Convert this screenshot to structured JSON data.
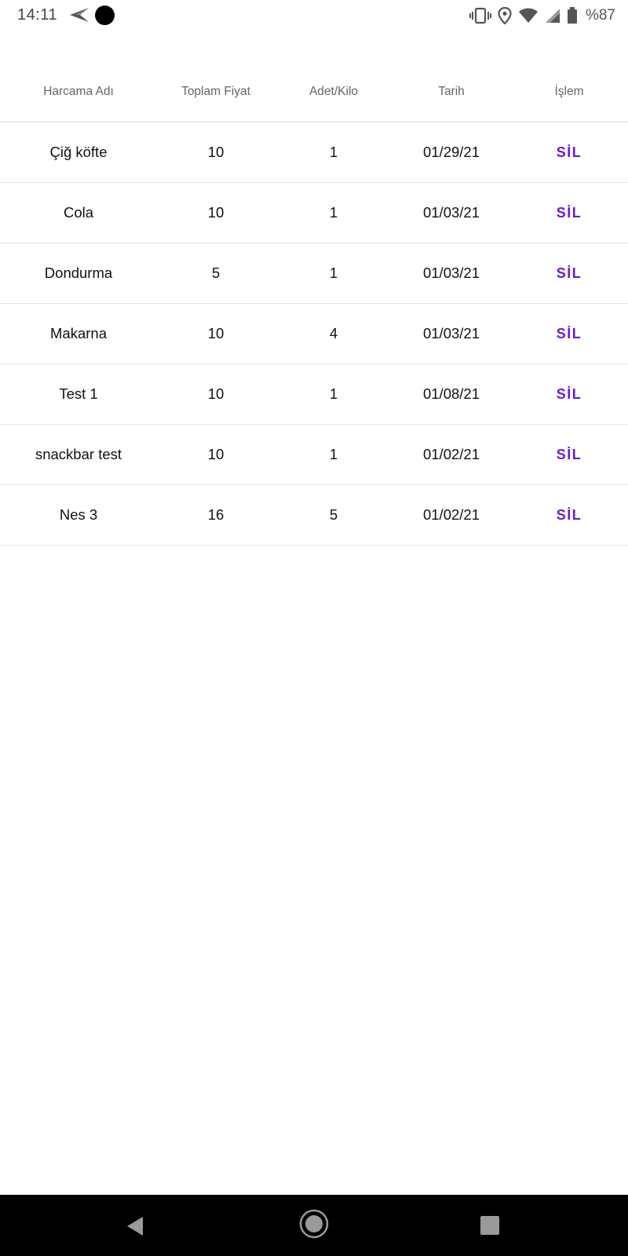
{
  "status_bar": {
    "time": "14:11",
    "battery_text": "%87",
    "icons": [
      "send-icon",
      "notification-dot-icon",
      "vibrate-icon",
      "location-icon",
      "wifi-icon",
      "signal-icon",
      "battery-icon"
    ]
  },
  "table": {
    "headers": [
      "Harcama Adı",
      "Toplam Fiyat",
      "Adet/Kilo",
      "Tarih",
      "İşlem"
    ],
    "action_label": "SİL",
    "rows": [
      {
        "name": "Çiğ köfte",
        "total": "10",
        "qty": "1",
        "date": "01/29/21"
      },
      {
        "name": "Cola",
        "total": "10",
        "qty": "1",
        "date": "01/03/21"
      },
      {
        "name": "Dondurma",
        "total": "5",
        "qty": "1",
        "date": "01/03/21"
      },
      {
        "name": "Makarna",
        "total": "10",
        "qty": "4",
        "date": "01/03/21"
      },
      {
        "name": "Test 1",
        "total": "10",
        "qty": "1",
        "date": "01/08/21"
      },
      {
        "name": "snackbar test",
        "total": "10",
        "qty": "1",
        "date": "01/02/21"
      },
      {
        "name": "Nes 3",
        "total": "16",
        "qty": "5",
        "date": "01/02/21"
      }
    ]
  },
  "colors": {
    "accent": "#6a1ad8",
    "nav_bar": "#000000",
    "divider": "#e6e6e6"
  },
  "nav_bar": {
    "icons": [
      "back-icon",
      "home-icon",
      "recent-apps-icon"
    ]
  }
}
